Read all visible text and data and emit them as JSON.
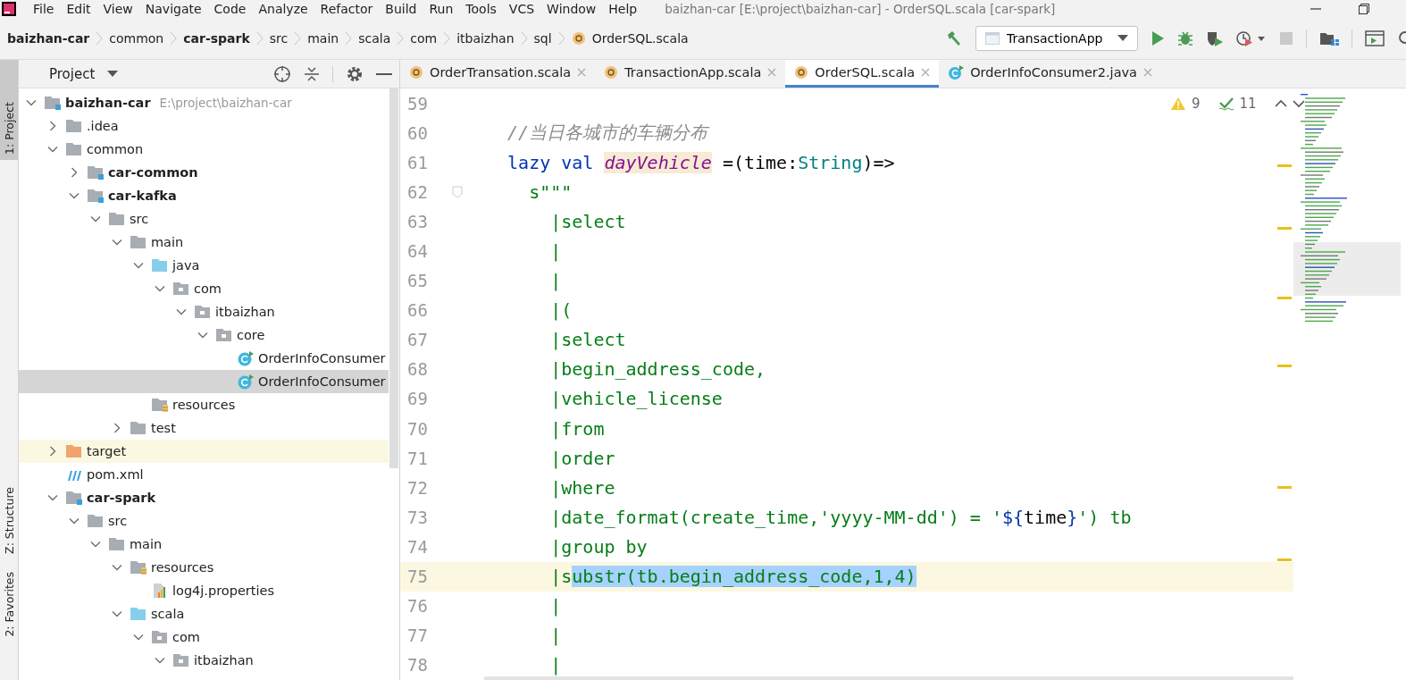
{
  "menu_bar": {
    "items": [
      "File",
      "Edit",
      "View",
      "Navigate",
      "Code",
      "Analyze",
      "Refactor",
      "Build",
      "Run",
      "Tools",
      "VCS",
      "Window",
      "Help"
    ],
    "title": "baizhan-car [E:\\project\\baizhan-car] - OrderSQL.scala [car-spark]"
  },
  "breadcrumbs": [
    {
      "label": "baizhan-car",
      "kind": "module"
    },
    {
      "label": "common",
      "kind": "folder"
    },
    {
      "label": "car-spark",
      "kind": "module"
    },
    {
      "label": "src",
      "kind": "folder"
    },
    {
      "label": "main",
      "kind": "folder"
    },
    {
      "label": "scala",
      "kind": "folder"
    },
    {
      "label": "com",
      "kind": "folder"
    },
    {
      "label": "itbaizhan",
      "kind": "folder"
    },
    {
      "label": "sql",
      "kind": "folder"
    },
    {
      "label": "OrderSQL.scala",
      "kind": "scala"
    }
  ],
  "run_config": {
    "label": "TransactionApp"
  },
  "side_strip": [
    {
      "label": "1: Project",
      "selected": true
    },
    {
      "label": "Z: Structure",
      "selected": false
    },
    {
      "label": "2: Favorites",
      "selected": false
    }
  ],
  "project_panel": {
    "title": "Project",
    "items": [
      {
        "name": "baizhan-car",
        "path": "E:\\project\\baizhan-car",
        "kind": "module",
        "expanded": true,
        "selected": false,
        "children": [
          {
            "name": ".idea",
            "kind": "folder",
            "expanded": false,
            "selected": false
          },
          {
            "name": "common",
            "kind": "folder",
            "expanded": true,
            "selected": false,
            "children": [
              {
                "name": "car-common",
                "kind": "module",
                "expanded": false,
                "selected": false
              },
              {
                "name": "car-kafka",
                "kind": "module",
                "expanded": true,
                "selected": false,
                "children": [
                  {
                    "name": "src",
                    "kind": "folder",
                    "expanded": true,
                    "selected": false,
                    "children": [
                      {
                        "name": "main",
                        "kind": "folder",
                        "expanded": true,
                        "selected": false,
                        "children": [
                          {
                            "name": "java",
                            "kind": "source",
                            "expanded": true,
                            "selected": false,
                            "children": [
                              {
                                "name": "com",
                                "kind": "package",
                                "expanded": true,
                                "selected": false,
                                "children": [
                                  {
                                    "name": "itbaizhan",
                                    "kind": "package",
                                    "expanded": true,
                                    "selected": false,
                                    "children": [
                                      {
                                        "name": "core",
                                        "kind": "package",
                                        "expanded": true,
                                        "selected": false,
                                        "children": [
                                          {
                                            "name": "OrderInfoConsumer",
                                            "kind": "class",
                                            "selected": false
                                          },
                                          {
                                            "name": "OrderInfoConsumer",
                                            "kind": "class",
                                            "selected": true
                                          }
                                        ]
                                      }
                                    ]
                                  }
                                ]
                              }
                            ]
                          },
                          {
                            "name": "resources",
                            "kind": "resources",
                            "selected": false
                          }
                        ]
                      },
                      {
                        "name": "test",
                        "kind": "folder",
                        "expanded": false,
                        "selected": false
                      }
                    ]
                  }
                ]
              }
            ]
          },
          {
            "name": "target",
            "kind": "excluded",
            "expanded": false,
            "selected": false
          },
          {
            "name": "pom.xml",
            "kind": "maven",
            "selected": false
          },
          {
            "name": "car-spark",
            "kind": "module",
            "expanded": true,
            "selected": false,
            "children": [
              {
                "name": "src",
                "kind": "folder",
                "expanded": true,
                "selected": false,
                "children": [
                  {
                    "name": "main",
                    "kind": "folder",
                    "expanded": true,
                    "selected": false,
                    "children": [
                      {
                        "name": "resources",
                        "kind": "resources",
                        "expanded": true,
                        "selected": false,
                        "children": [
                          {
                            "name": "log4j.properties",
                            "kind": "properties",
                            "selected": false
                          }
                        ]
                      },
                      {
                        "name": "scala",
                        "kind": "source",
                        "expanded": true,
                        "selected": false,
                        "children": [
                          {
                            "name": "com",
                            "kind": "package",
                            "expanded": true,
                            "selected": false,
                            "children": [
                              {
                                "name": "itbaizhan",
                                "kind": "package",
                                "expanded": true,
                                "selected": false
                              }
                            ]
                          }
                        ]
                      }
                    ]
                  }
                ]
              }
            ]
          }
        ]
      }
    ]
  },
  "editor_tabs": [
    {
      "label": "OrderTransation.scala",
      "kind": "scala",
      "selected": false
    },
    {
      "label": "TransactionApp.scala",
      "kind": "scala",
      "selected": false
    },
    {
      "label": "OrderSQL.scala",
      "kind": "scala",
      "selected": true
    },
    {
      "label": "OrderInfoConsumer2.java",
      "kind": "class",
      "selected": false
    }
  ],
  "inspections": {
    "warnings": "9",
    "weak_warnings": "11"
  },
  "code_lines": [
    {
      "number": "59",
      "current": false
    },
    {
      "number": "60",
      "current": false,
      "segments": [
        {
          "text": "  //当日各城市的车辆分布",
          "kind": "comment"
        }
      ]
    },
    {
      "number": "61",
      "current": false,
      "segments": [
        {
          "text": "  lazy val ",
          "kind": "keyword"
        },
        {
          "text": "dayVehicle",
          "kind": "definition"
        },
        {
          "text": " =(time:",
          "kind": "plain"
        },
        {
          "text": "String",
          "kind": "type"
        },
        {
          "text": ")=>",
          "kind": "plain"
        }
      ]
    },
    {
      "number": "62",
      "current": false,
      "segments": [
        {
          "text": "    s\"\"\"",
          "kind": "string"
        }
      ]
    },
    {
      "number": "63",
      "current": false,
      "segments": [
        {
          "text": "      |select",
          "kind": "string"
        }
      ]
    },
    {
      "number": "64",
      "current": false,
      "segments": [
        {
          "text": "      |",
          "kind": "string"
        }
      ]
    },
    {
      "number": "65",
      "current": false,
      "segments": [
        {
          "text": "      |",
          "kind": "string"
        }
      ]
    },
    {
      "number": "66",
      "current": false,
      "segments": [
        {
          "text": "      |(",
          "kind": "string"
        }
      ]
    },
    {
      "number": "67",
      "current": false,
      "segments": [
        {
          "text": "      |select",
          "kind": "string"
        }
      ]
    },
    {
      "number": "68",
      "current": false,
      "segments": [
        {
          "text": "      |begin_address_code,",
          "kind": "string"
        }
      ]
    },
    {
      "number": "69",
      "current": false,
      "segments": [
        {
          "text": "      |vehicle_license",
          "kind": "string"
        }
      ]
    },
    {
      "number": "70",
      "current": false,
      "segments": [
        {
          "text": "      |from",
          "kind": "string"
        }
      ]
    },
    {
      "number": "71",
      "current": false,
      "segments": [
        {
          "text": "      |order",
          "kind": "string"
        }
      ]
    },
    {
      "number": "72",
      "current": false,
      "segments": [
        {
          "text": "      |where",
          "kind": "string"
        }
      ]
    },
    {
      "number": "73",
      "current": false,
      "segments": [
        {
          "text": "      |date_format(create_time,'yyyy-MM-dd') = '",
          "kind": "string"
        },
        {
          "text": "${",
          "kind": "interp"
        },
        {
          "text": "time",
          "kind": "plain"
        },
        {
          "text": "}",
          "kind": "interp"
        },
        {
          "text": "') tb",
          "kind": "string"
        }
      ]
    },
    {
      "number": "74",
      "current": false,
      "segments": [
        {
          "text": "      |group by",
          "kind": "string"
        }
      ]
    },
    {
      "number": "75",
      "current": true,
      "segments": [
        {
          "text": "      |s",
          "kind": "string"
        },
        {
          "text": "ubstr(tb.begin_address_code,1,4)",
          "kind": "selected"
        }
      ]
    },
    {
      "number": "76",
      "current": false,
      "segments": [
        {
          "text": "      |",
          "kind": "string"
        }
      ]
    },
    {
      "number": "77",
      "current": false,
      "segments": [
        {
          "text": "      |",
          "kind": "string"
        }
      ]
    },
    {
      "number": "78",
      "current": false,
      "segments": [
        {
          "text": "      |",
          "kind": "string"
        }
      ]
    }
  ]
}
